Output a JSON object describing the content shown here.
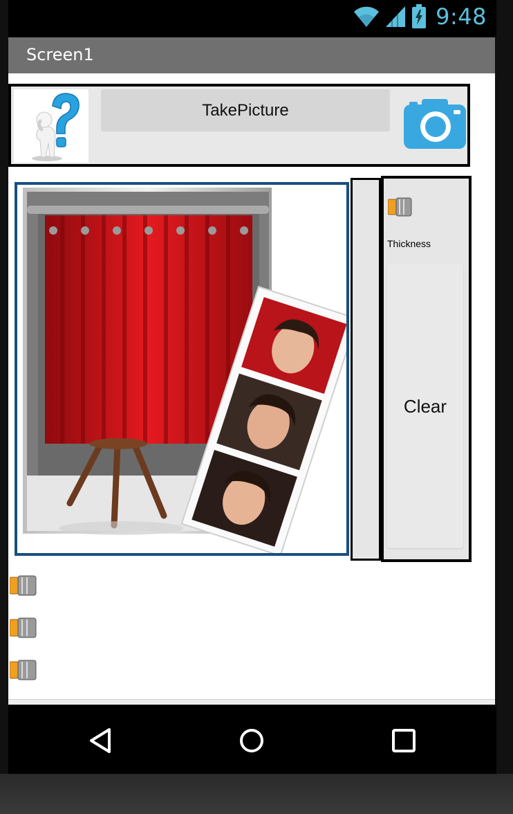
{
  "status_bar": {
    "time": "9:48",
    "icons": [
      "wifi-icon",
      "signal-icon",
      "battery-charging-icon"
    ]
  },
  "title_bar": {
    "title": "Screen1"
  },
  "top_arrangement": {
    "help_image": "help-person-question-mark-icon",
    "take_picture_button_label": "TakePicture",
    "camera_button_icon": "camera-icon"
  },
  "canvas": {
    "background_image": "photo-booth-image"
  },
  "right_panel": {
    "thickness_label": "Thickness",
    "clear_button_label": "Clear"
  },
  "sliders": [
    {
      "name": "slider-1"
    },
    {
      "name": "slider-2"
    },
    {
      "name": "slider-3"
    }
  ],
  "navigation": {
    "buttons": [
      "back-icon",
      "home-icon",
      "recents-icon"
    ]
  },
  "colors": {
    "status_time": "#5bc0de",
    "title_bar": "#707070",
    "canvas_border": "#1a4f80",
    "curtain_red": "#d81418",
    "camera_blue": "#3aa8e0"
  }
}
